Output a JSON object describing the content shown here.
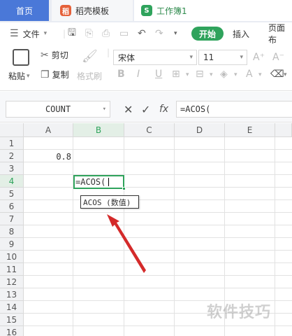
{
  "tabs": {
    "home": "首页",
    "daoke": "稻壳模板",
    "workbook": "工作簿1"
  },
  "menu": {
    "file": "文件",
    "start": "开始",
    "insert": "插入",
    "page_layout": "页面布"
  },
  "ribbon": {
    "paste": "粘贴",
    "cut": "剪切",
    "copy": "复制",
    "format_painter": "格式刷",
    "font_name": "宋体",
    "font_size": "11",
    "bold": "B",
    "italic": "I",
    "underline": "U",
    "grow": "A⁺",
    "shrink": "A⁻"
  },
  "formula_bar": {
    "name_box": "COUNT",
    "fx": "fx",
    "formula": "=ACOS("
  },
  "grid": {
    "columns": [
      "A",
      "B",
      "C",
      "D",
      "E"
    ],
    "rows": [
      "1",
      "2",
      "3",
      "4",
      "5",
      "6",
      "7",
      "8",
      "9",
      "10",
      "11",
      "12",
      "13",
      "14",
      "15",
      "16"
    ],
    "cell_a2": "0.8",
    "cell_b4": "=ACOS(",
    "tooltip": "ACOS (数值)"
  },
  "watermark": "软件技巧",
  "colors": {
    "accent": "#2fa35c",
    "tab_home": "#4a78d8",
    "arrow": "#d42a2a"
  }
}
